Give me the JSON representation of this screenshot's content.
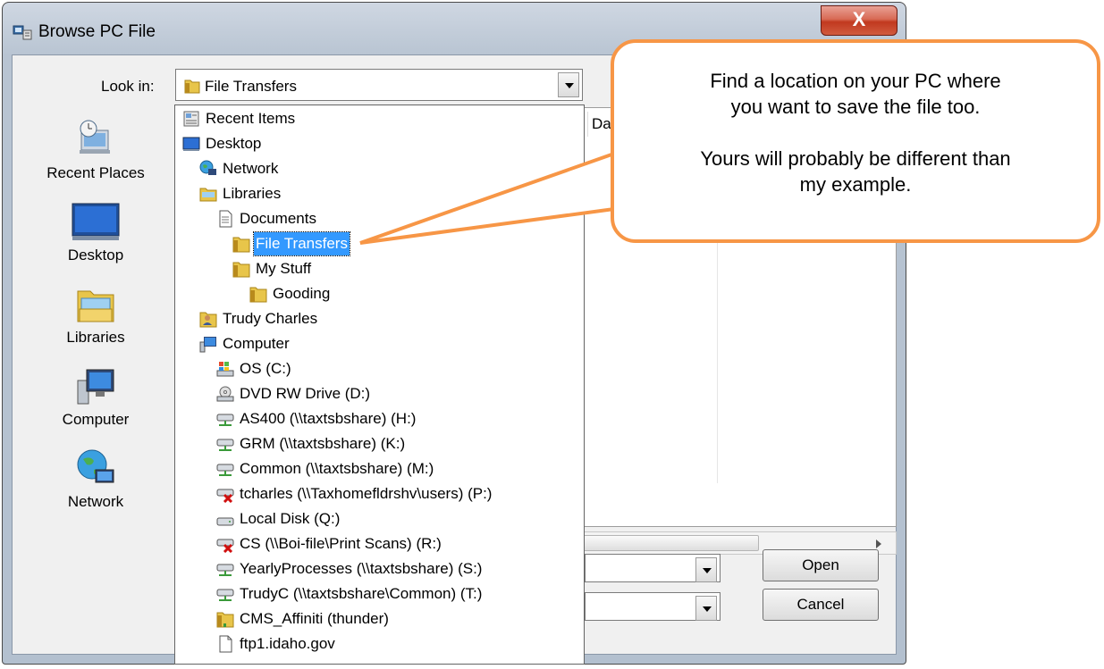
{
  "window": {
    "title": "Browse PC File",
    "close_label": "X"
  },
  "lookin": {
    "label": "Look in:",
    "value": "File Transfers"
  },
  "places": [
    {
      "label": "Recent Places",
      "icon": "recent-places-icon"
    },
    {
      "label": "Desktop",
      "icon": "desktop-icon"
    },
    {
      "label": "Libraries",
      "icon": "libraries-icon"
    },
    {
      "label": "Computer",
      "icon": "computer-icon"
    },
    {
      "label": "Network",
      "icon": "network-icon"
    }
  ],
  "filelist": {
    "column_date": "Dat"
  },
  "dropdown": {
    "items": [
      {
        "label": "Recent Items",
        "icon": "recent-items-icon"
      },
      {
        "label": "Desktop",
        "icon": "desktop-icon"
      },
      {
        "label": "Network",
        "icon": "network-icon"
      },
      {
        "label": "Libraries",
        "icon": "libraries-icon"
      },
      {
        "label": "Documents",
        "icon": "document-icon"
      },
      {
        "label": "File Transfers",
        "icon": "folder-icon",
        "selected": true
      },
      {
        "label": "My Stuff",
        "icon": "folder-icon"
      },
      {
        "label": "Gooding",
        "icon": "folder-icon"
      },
      {
        "label": "Trudy Charles",
        "icon": "user-icon"
      },
      {
        "label": "Computer",
        "icon": "computer-icon"
      },
      {
        "label": "OS (C:)",
        "icon": "os-drive-icon"
      },
      {
        "label": "DVD RW Drive (D:)",
        "icon": "dvd-drive-icon"
      },
      {
        "label": "AS400 (\\\\taxtsbshare) (H:)",
        "icon": "network-drive-icon"
      },
      {
        "label": "GRM (\\\\taxtsbshare) (K:)",
        "icon": "network-drive-icon"
      },
      {
        "label": "Common (\\\\taxtsbshare) (M:)",
        "icon": "network-drive-icon"
      },
      {
        "label": "tcharles (\\\\Taxhomefldrshv\\users) (P:)",
        "icon": "disconnected-drive-icon"
      },
      {
        "label": "Local Disk (Q:)",
        "icon": "local-disk-icon"
      },
      {
        "label": "CS (\\\\Boi-file\\Print Scans) (R:)",
        "icon": "disconnected-drive-icon"
      },
      {
        "label": "YearlyProcesses (\\\\taxtsbshare) (S:)",
        "icon": "network-drive-icon"
      },
      {
        "label": "TrudyC (\\\\taxtsbshare\\Common) (T:)",
        "icon": "network-drive-icon"
      },
      {
        "label": "CMS_Affiniti (thunder)",
        "icon": "folder-icon"
      },
      {
        "label": "ftp1.idaho.gov",
        "icon": "ftp-page-icon"
      }
    ]
  },
  "buttons": {
    "open": "Open",
    "cancel": "Cancel"
  },
  "callout": {
    "line1": "Find a location on your PC where",
    "line2": "you want to save the file too.",
    "line3": "Yours will probably be different than",
    "line4": "my example.",
    "border_color": "#f79646"
  }
}
